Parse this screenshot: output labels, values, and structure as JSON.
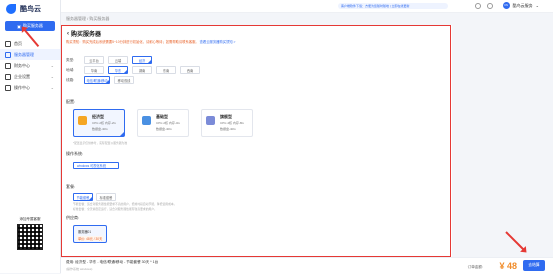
{
  "app": {
    "brand": "酷鸟云"
  },
  "sidebar": {
    "buy_button": "购买服务器",
    "items": [
      {
        "label": "首页",
        "active": false,
        "caret": ""
      },
      {
        "label": "服务器管理",
        "active": true,
        "caret": ""
      },
      {
        "label": "财务中心",
        "active": false,
        "caret": "⌄"
      },
      {
        "label": "企业设置",
        "active": false,
        "caret": "⌄"
      },
      {
        "label": "操作中心",
        "active": false,
        "caret": "⌄"
      }
    ],
    "qr_title": "添加专属客服"
  },
  "topbar": {
    "notice": "客户端软件下载：方便为您随时随地 | 立即在线更新",
    "user_name": "酷鸟云服务",
    "avatar_text": "KN"
  },
  "breadcrumb": "服务器管理 / 购买服务器",
  "page": {
    "title": "购买服务器",
    "tip_text": "购买须知：购买完成后系统需要5~10分钟进行初始化，请耐心等待；如需帮助请联系客服。",
    "tip_link": "查看云服务器购买须知 >",
    "rows": [
      {
        "label": "类型:",
        "options": [
          {
            "text": "云平台",
            "sel": false
          },
          {
            "text": "云端",
            "sel": false
          },
          {
            "text": "经济",
            "sel": true
          }
        ]
      },
      {
        "label": "地域:",
        "options": [
          {
            "text": "华南",
            "sel": false
          },
          {
            "text": "华东",
            "sel": true
          },
          {
            "text": "湖南",
            "sel": false
          },
          {
            "text": "东南",
            "sel": false
          },
          {
            "text": "西南",
            "sel": false
          }
        ]
      },
      {
        "label": "线路:",
        "options": [
          {
            "text": "电信/联通/移动",
            "sel": true
          },
          {
            "text": "移动双线",
            "sel": false
          }
        ]
      }
    ],
    "config_label": "配置:",
    "configs": [
      {
        "name": "经济型",
        "spec": "CPU-2核 内存-2G",
        "disk": "数据盘-40G",
        "sel": true,
        "color": "#f5a623"
      },
      {
        "name": "基础型",
        "spec": "CPU-2核 内存-4G",
        "disk": "数据盘-40G",
        "sel": false,
        "color": "#4a90e2"
      },
      {
        "name": "旗舰型",
        "spec": "CPU-4核 内存-8G",
        "disk": "数据盘-40G",
        "sel": false,
        "color": "#7b8bd8"
      }
    ],
    "config_note": "*配置显示仅供参考，实际配置以服务器为准",
    "os_label": "操作系统:",
    "os_value": "windows 可视化系统",
    "plan_label": "套餐:",
    "plans": [
      {
        "text": "节能套餐",
        "sel": true
      },
      {
        "text": "标准套餐",
        "sel": false
      }
    ],
    "plan_note1": "节能套餐：适合对服务器性能要求不高的用户，低峰时段自动节能，降低使用成本。",
    "plan_note2": "标准套餐：全天候稳定运行，适合对服务器性能有较高要求的用户。",
    "supplier_label": "供应商:",
    "supplier_name": "服务器01",
    "supplier_price": "单价: 48元 / 30天"
  },
  "footer": {
    "desc": "费用: 经济型 - 华东 - 电信/联通/移动 - 节能套餐 30天 * 1台",
    "desc2": "(操作系统 windows)",
    "fee_label": "订单金额:",
    "price": "¥ 48",
    "buy_now": "去结算"
  },
  "colors": {
    "accent": "#2f6bf0",
    "highlight": "#e53935",
    "price": "#f08c2a"
  }
}
